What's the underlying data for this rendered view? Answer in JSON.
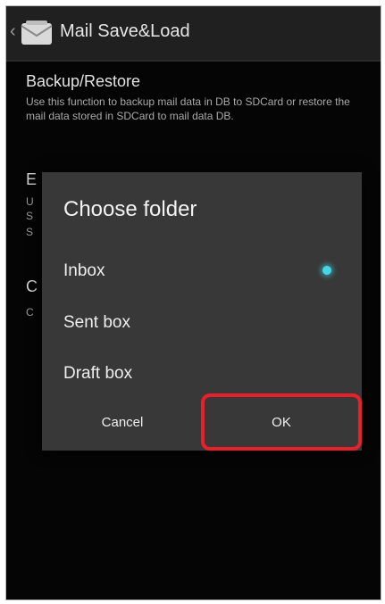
{
  "action_bar": {
    "back_glyph": "‹",
    "title": "Mail Save&Load",
    "icon": "mail-envelope-icon"
  },
  "background": {
    "backup_title": "Backup/Restore",
    "backup_desc": "Use this function to backup mail data in DB to SDCard or restore the mail data stored in SDCard to mail data DB.",
    "partial_letter_1": "E",
    "partial_frag_1": "U",
    "partial_frag_2": "S",
    "partial_frag_3": "S",
    "partial_letter_2": "C",
    "partial_frag_4": "C"
  },
  "dialog": {
    "title": "Choose folder",
    "options": [
      {
        "label": "Inbox",
        "selected": true
      },
      {
        "label": "Sent box",
        "selected": false
      },
      {
        "label": "Draft box",
        "selected": false
      }
    ],
    "cancel_label": "Cancel",
    "ok_label": "OK"
  },
  "colors": {
    "highlight": "#e8202a",
    "radio_accent": "#44d8e6"
  }
}
